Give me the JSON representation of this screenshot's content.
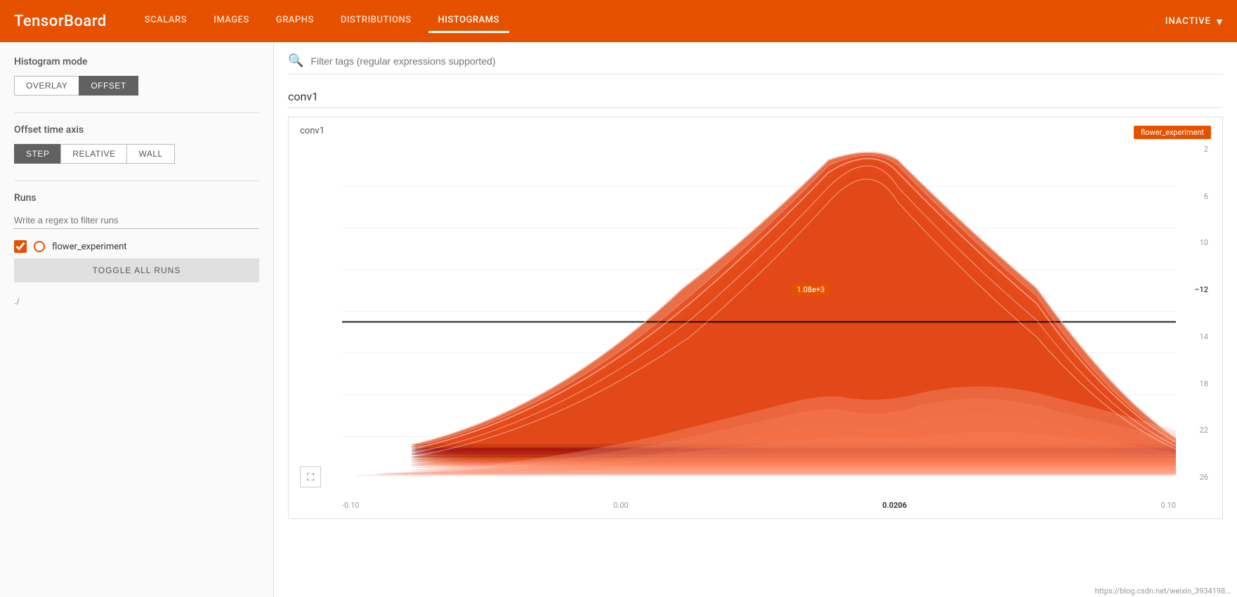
{
  "header": {
    "logo": "TensorBoard",
    "nav": [
      {
        "id": "scalars",
        "label": "SCALARS",
        "active": false
      },
      {
        "id": "images",
        "label": "IMAGES",
        "active": false
      },
      {
        "id": "graphs",
        "label": "GRAPHS",
        "active": false
      },
      {
        "id": "distributions",
        "label": "DISTRIBUTIONS",
        "active": false
      },
      {
        "id": "histograms",
        "label": "HISTOGRAMS",
        "active": true
      }
    ],
    "status": "INACTIVE"
  },
  "sidebar": {
    "histogram_mode_label": "Histogram mode",
    "overlay_label": "OVERLAY",
    "offset_label": "OFFSET",
    "offset_axis_label": "Offset time axis",
    "step_label": "STEP",
    "relative_label": "RELATIVE",
    "wall_label": "WALL",
    "runs_label": "Runs",
    "filter_placeholder": "Write a regex to filter runs",
    "run_name": "flower_experiment",
    "toggle_all_label": "TOGGLE ALL RUNS",
    "run_path": "./"
  },
  "content": {
    "filter_placeholder": "Filter tags (regular expressions supported)",
    "section_label": "conv1",
    "chart": {
      "title": "conv1",
      "experiment_badge": "flower_experiment",
      "tooltip_value": "1.08e+3",
      "x_axis": [
        "-0.10",
        "0.00",
        "0.0206",
        "0.10"
      ],
      "y_axis": [
        "2",
        "6",
        "10",
        "-12",
        "14",
        "18",
        "22",
        "26"
      ]
    }
  },
  "status_bar": {
    "url": "https://blog.csdn.net/weixin_3934198..."
  },
  "icons": {
    "search": "🔍",
    "chevron_down": "▾",
    "fullscreen": "⛶"
  }
}
